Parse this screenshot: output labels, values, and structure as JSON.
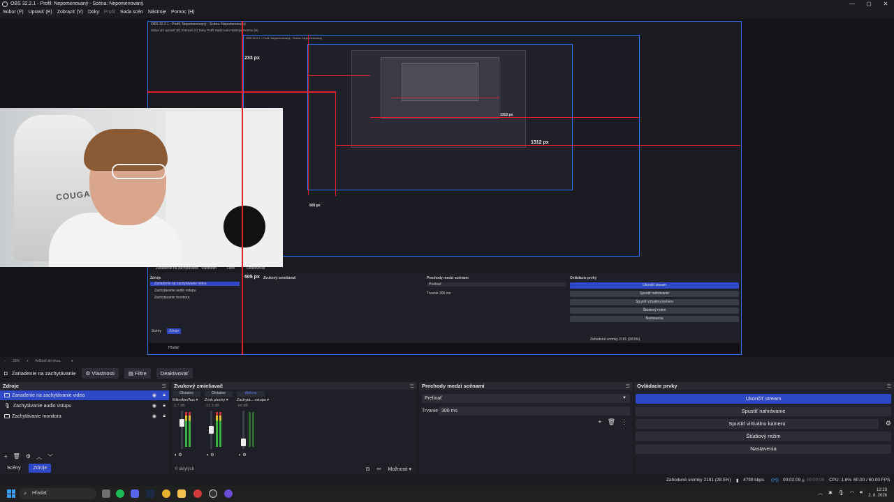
{
  "window": {
    "title": "OBS 32.2.1 - Profil: Nepomenovaný - Scéna: Nepomenovaný",
    "controls": [
      "—",
      "▢",
      "✕"
    ]
  },
  "menu": {
    "items": [
      "Súbor (F)",
      "Upraviť (E)",
      "Zobraziť (V)",
      "Doky",
      "Profil",
      "Sada scén",
      "Nástroje",
      "Pomoc (H)"
    ]
  },
  "preview": {
    "label_233": "233 px",
    "label_1312_small": "1312 px",
    "label_1312": "1312 px",
    "label_505": "505 px",
    "label_505_small": "505 px",
    "webcam_text": "COUGAR",
    "inner_title": "OBS 32.2.1 - Profil: Nepomenovaný - Scéna: Nepomenovaný",
    "inner_menu": "Súbor (F)   Upraviť (E)   Zobraziť (V)   Doky   Profil   Sada scén   Nástroje   Pomoc (H)",
    "inner": {
      "toolbar": "Zariadenie na zachytávanie",
      "toolbar_props": "Vlastnosti",
      "toolbar_filters": "Filtre",
      "toolbar_deact": "Deaktivovať",
      "sources_title": "Zdroje",
      "source1": "Zariadenie na zachytávanie videa",
      "source2": "Zachytávanie audio vstupu",
      "source3": "Zachytávanie monitora",
      "scenes_tab": "Scény",
      "sources_tab": "Zdroje",
      "mixer_title": "Zvukový zmiešavač",
      "transitions_title": "Prechody medzi scénami",
      "transition_value": "Prelínať",
      "duration_label": "Trvanie",
      "duration_value": "300 ms",
      "controls_title": "Ovládacie prvky",
      "stop_stream": "Ukončiť stream",
      "start_rec": "Spustiť nahrávanie",
      "virtual_cam": "Spustiť virtuálnu kameru",
      "studio": "Štúdiový režim",
      "settings": "Nastavenia",
      "status": "Zahodené snímky 2191 (28,5%)",
      "search": "Hľadať"
    }
  },
  "zoombar": {
    "zoom": "33%",
    "fit": "Veľkosť do okna"
  },
  "source_toolbar": {
    "selected": "Zariadenie na zachytávanie",
    "properties": "Vlastnosti",
    "filters": "Filtre",
    "deactivate": "Deaktivovať"
  },
  "sources": {
    "title": "Zdroje",
    "items": [
      {
        "label": "Zariadenie na zachytávanie videa"
      },
      {
        "label": "Zachytávanie audio vstupu"
      },
      {
        "label": "Zachytávanie monitora"
      }
    ],
    "tab_scenes": "Scény",
    "tab_sources": "Zdroje"
  },
  "mixer": {
    "title": "Zvukový zmiešavač",
    "channels": [
      {
        "tab": "Globálne",
        "name": "Mikrofón/Aux ▾",
        "db": "-3.7 dB"
      },
      {
        "tab": "Globálne",
        "name": "Zvuk plochy ▾",
        "db": "-12.3 dB"
      },
      {
        "tab": "Aktívna",
        "name": "Zachytá... vstupu ▾",
        "db": "-inf dB"
      }
    ],
    "hidden": "0 skrytých",
    "options": "Možnosti"
  },
  "transitions": {
    "title": "Prechody medzi scénami",
    "selected": "Prelínať",
    "duration_label": "Trvanie",
    "duration_value": "300 ms"
  },
  "controls": {
    "title": "Ovládacie prvky",
    "stop_stream": "Ukončiť stream",
    "start_recording": "Spustiť nahrávanie",
    "virtual_camera": "Spustiť virtuálnu kameru",
    "studio_mode": "Štúdiový režim",
    "settings": "Nastavenia"
  },
  "status": {
    "dropped": "Zahodené snímky 2191 (28.5%)",
    "bitrate": "4799 kbps",
    "stream_time": "00:02:09",
    "rec_time": "00:00:00",
    "cpu": "CPU: 1.6%",
    "fps": "60.00 / 60.00 FPS"
  },
  "taskbar": {
    "search": "Hľadať",
    "time": "12:23",
    "date": "2. 8. 2026"
  },
  "colors": {
    "accent": "#2f48c8",
    "preview_border": "#2f74ff",
    "guide_red": "#e0202a"
  }
}
